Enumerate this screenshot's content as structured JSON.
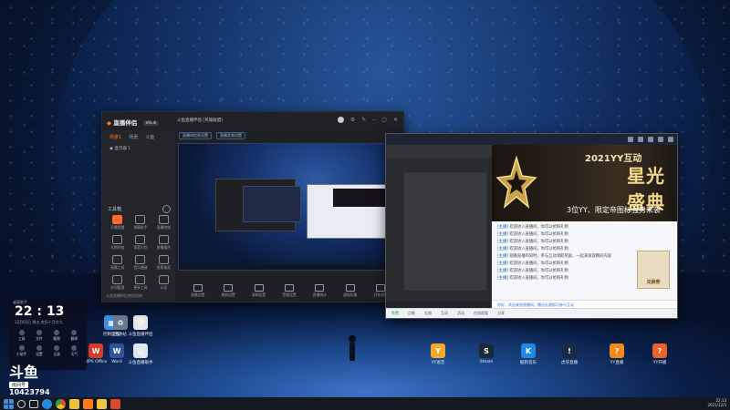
{
  "main_window": {
    "brand": "直播伴侣",
    "version": "V6.4",
    "title": "斗鱼直播伴侣 [英雄联盟]",
    "tabs": [
      "场景1",
      "场景",
      "斗鱼"
    ],
    "scene": "显示器 1",
    "subbar": [
      "直播间信息设置",
      "直播音频设置"
    ],
    "toolbox_title": "工具箱",
    "tools": [
      "开播提醒",
      "弹幕助手",
      "直播特效",
      "礼物特效",
      "语音识别",
      "直播插件",
      "直播工具",
      "音乐播放",
      "投票抽奖",
      "房间管理",
      "更多工具",
      "公告"
    ],
    "bottom_note": "斗鱼直播伴侣使用说明",
    "controls": [
      "直播设置",
      "美颜设置",
      "录制设置",
      "音频设置",
      "直播统计",
      "虚拟形象",
      "开始直播"
    ]
  },
  "right_window": {
    "banner": {
      "top": "2021YY互动",
      "title": "星光盛典",
      "sub": "3位YY、限定帝图标强势来袭"
    },
    "chat": [
      {
        "name": "[主播]",
        "text": "欢迎进入直播间，你可以抢购礼物"
      },
      {
        "name": "[主播]",
        "text": "欢迎进入直播间，你可以抢购礼物"
      },
      {
        "name": "[主播]",
        "text": "欢迎进入直播间，你可以抢购礼物"
      },
      {
        "name": "[主播]",
        "text": "欢迎进入直播间，你可以抢购礼物"
      },
      {
        "name": "[主播]",
        "text": "观看直播的同时，参与互动领取奖励，一起来发现精彩内容"
      },
      {
        "name": "[主播]",
        "text": "欢迎进入直播间，你可以抢购礼物"
      },
      {
        "name": "[主播]",
        "text": "欢迎进入直播间，你可以抢购礼物"
      },
      {
        "name": "[主播]",
        "text": "欢迎进入直播间，你可以抢购礼物"
      }
    ],
    "badge": "兑换券",
    "input_hint": "你好，欢迎来到直播间，赠送礼物即可参与互动",
    "bottom_items": [
      "免费",
      "点歌",
      "礼物",
      "互动",
      "活动",
      "在线观看",
      "分享"
    ]
  },
  "desktop_icons": [
    {
      "label": "控制面板",
      "color": "#3a8fe0",
      "glyph": "▦"
    },
    {
      "label": "回收站",
      "color": "#6b7a90",
      "glyph": "♻"
    },
    {
      "label": "斗鱼直播伴侣",
      "color": "#e8e8e8",
      "glyph": "⏻"
    },
    {
      "label": "WPS Office",
      "color": "#d83b2a",
      "glyph": "W"
    },
    {
      "label": "Word",
      "color": "#2b579a",
      "glyph": "W"
    },
    {
      "label": "斗鱼直播助手",
      "color": "#dfe6f0",
      "glyph": "◎"
    },
    {
      "label": "YY语音",
      "color": "#f2a92a",
      "glyph": "Y"
    },
    {
      "label": "Steam",
      "color": "#1b2838",
      "glyph": "S"
    },
    {
      "label": "酷狗音乐",
      "color": "#1e88e5",
      "glyph": "K"
    },
    {
      "label": "虎牙直播",
      "color": "#1a2a44",
      "glyph": "!"
    },
    {
      "label": "YY直播",
      "color": "#f08b1a",
      "glyph": "?"
    },
    {
      "label": "YY开播",
      "color": "#e8622a",
      "glyph": "?"
    }
  ],
  "clock_widget": {
    "header": "桌面助手",
    "time": "22 : 13",
    "date": "12月03日  周五  农历十月廿九",
    "apps": [
      "工具",
      "文件",
      "截图",
      "翻译",
      "小助手",
      "设置",
      "记录",
      "天气"
    ]
  },
  "watermark": {
    "brand": "斗鱼",
    "room_label": "房间号",
    "room": "10423794"
  },
  "taskbar": {
    "time": "22:13",
    "date": "2021/12/3"
  }
}
